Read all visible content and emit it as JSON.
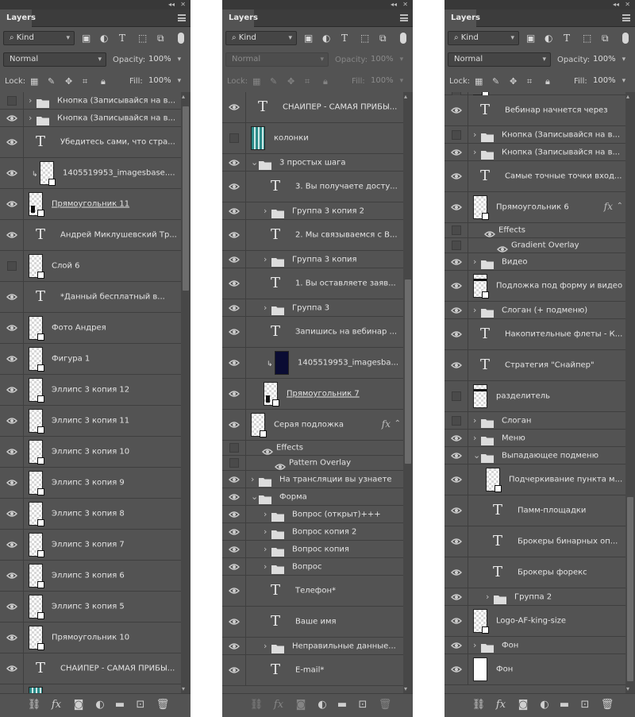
{
  "common": {
    "tab": "Layers",
    "filter": "Kind",
    "blend": "Normal",
    "opacity_label": "Opacity:",
    "opacity": "100%",
    "lock_label": "Lock:",
    "fill_label": "Fill:",
    "fill": "100%"
  },
  "panel1": {
    "layers": [
      {
        "v": 0,
        "a": 1,
        "ic": "folder",
        "t": "Кнопка (Записывайся на в...",
        "h": 22
      },
      {
        "v": 1,
        "a": 1,
        "ic": "folder",
        "t": "Кнопка (Записывайся на в...",
        "h": 22
      },
      {
        "v": 1,
        "ic": "text",
        "t": "Убедитесь сами, что стра...",
        "h": 39
      },
      {
        "v": 1,
        "ic": "thumb",
        "th": "check",
        "clip": 1,
        "t": "1405519953_imagesbase....",
        "h": 39
      },
      {
        "v": 1,
        "ic": "thumb",
        "th": "white-blk",
        "t": "Прямоугольник 11",
        "u": 1,
        "h": 39
      },
      {
        "v": 1,
        "ic": "text",
        "t": "Андрей Миклушевский Тр...",
        "h": 39
      },
      {
        "v": 0,
        "ic": "thumb",
        "th": "check",
        "t": "Слой 6",
        "h": 39
      },
      {
        "v": 1,
        "ic": "text",
        "t": "*Данный бесплатный в...",
        "h": 39
      },
      {
        "v": 1,
        "ic": "thumb",
        "th": "check",
        "t": "Фото Андрея",
        "h": 39
      },
      {
        "v": 1,
        "ic": "thumb",
        "th": "shape",
        "t": "Фигура 1",
        "h": 39
      },
      {
        "v": 1,
        "ic": "thumb",
        "th": "shape",
        "t": "Эллипс 3 копия 12",
        "h": 39
      },
      {
        "v": 1,
        "ic": "thumb",
        "th": "shape",
        "t": "Эллипс 3 копия 11",
        "h": 39
      },
      {
        "v": 1,
        "ic": "thumb",
        "th": "shape",
        "t": "Эллипс 3 копия 10",
        "h": 39
      },
      {
        "v": 1,
        "ic": "thumb",
        "th": "shape",
        "t": "Эллипс 3 копия 9",
        "h": 39
      },
      {
        "v": 1,
        "ic": "thumb",
        "th": "shape",
        "t": "Эллипс 3 копия 8",
        "h": 39
      },
      {
        "v": 1,
        "ic": "thumb",
        "th": "shape",
        "t": "Эллипс 3 копия 7",
        "h": 39
      },
      {
        "v": 1,
        "ic": "thumb",
        "th": "shape",
        "t": "Эллипс 3 копия 6",
        "h": 39
      },
      {
        "v": 1,
        "ic": "thumb",
        "th": "shape",
        "t": "Эллипс 3 копия 5",
        "h": 39
      },
      {
        "v": 1,
        "ic": "thumb",
        "th": "shape",
        "t": "Прямоугольник 10",
        "h": 39
      },
      {
        "v": 1,
        "ic": "text",
        "t": "СНАЙПЕР - САМАЯ ПРИБЫ...",
        "h": 39
      },
      {
        "v": 1,
        "ic": "thumb",
        "th": "teal",
        "t": "",
        "h": 30
      }
    ]
  },
  "panel2": {
    "layers": [
      {
        "v": 1,
        "ic": "text",
        "t": "СНАЙПЕР - САМАЯ ПРИБЫ...",
        "h": 39
      },
      {
        "v": 0,
        "ic": "thumb",
        "th": "teal",
        "t": "колонки",
        "h": 39
      },
      {
        "v": 1,
        "a": 2,
        "ic": "folder",
        "t": "3 простых шага",
        "h": 22
      },
      {
        "v": 1,
        "ind": 1,
        "ic": "text",
        "t": "3. Вы получаете досту...",
        "h": 39
      },
      {
        "v": 1,
        "ind": 1,
        "a": 1,
        "ic": "folder",
        "t": "Группа 3 копия 2",
        "h": 22
      },
      {
        "v": 1,
        "ind": 1,
        "ic": "text",
        "t": "2. Мы связываемся с В...",
        "h": 39
      },
      {
        "v": 1,
        "ind": 1,
        "a": 1,
        "ic": "folder",
        "t": "Группа 3 копия",
        "h": 22
      },
      {
        "v": 1,
        "ind": 1,
        "ic": "text",
        "t": "1. Вы оставляете заяв...",
        "h": 39
      },
      {
        "v": 1,
        "ind": 1,
        "a": 1,
        "ic": "folder",
        "t": "Группа 3",
        "h": 22
      },
      {
        "v": 1,
        "ind": 1,
        "ic": "text",
        "t": "Запишись на вебинар ...",
        "h": 39
      },
      {
        "v": 1,
        "ind": 1,
        "ic": "thumb",
        "th": "dark",
        "clip": 1,
        "t": "1405519953_imagesba...",
        "h": 39
      },
      {
        "v": 1,
        "ind": 1,
        "ic": "thumb",
        "th": "white-blk",
        "t": "Прямоугольник 7",
        "u": 1,
        "h": 39
      },
      {
        "v": 1,
        "ic": "thumb",
        "th": "shape",
        "t": "Серая подложка",
        "fx": 1,
        "h": 39
      },
      {
        "v": 0,
        "sub": 1,
        "t": "Effects",
        "h": 19
      },
      {
        "v": 0,
        "sub": 2,
        "t": "Pattern Overlay",
        "h": 19
      },
      {
        "v": 1,
        "a": 1,
        "ic": "folder",
        "t": "На трансляции вы узнаете",
        "h": 22
      },
      {
        "v": 1,
        "a": 2,
        "ic": "folder",
        "t": "Форма",
        "h": 22
      },
      {
        "v": 1,
        "ind": 1,
        "a": 1,
        "ic": "folder",
        "t": "Вопрос (открыт)+++",
        "h": 22
      },
      {
        "v": 1,
        "ind": 1,
        "a": 1,
        "ic": "folder",
        "t": "Вопрос копия 2",
        "h": 22
      },
      {
        "v": 1,
        "ind": 1,
        "a": 1,
        "ic": "folder",
        "t": "Вопрос копия",
        "h": 22
      },
      {
        "v": 1,
        "ind": 1,
        "a": 1,
        "ic": "folder",
        "t": "Вопрос",
        "h": 22
      },
      {
        "v": 1,
        "ind": 1,
        "ic": "text",
        "t": "Телефон*",
        "h": 39
      },
      {
        "v": 1,
        "ind": 1,
        "ic": "text",
        "t": "Ваше имя",
        "h": 39
      },
      {
        "v": 1,
        "ind": 1,
        "a": 1,
        "ic": "folder",
        "t": "Неправильные данные...",
        "h": 22
      },
      {
        "v": 1,
        "ind": 1,
        "ic": "text",
        "t": "E-mail*",
        "h": 39
      }
    ]
  },
  "panel3": {
    "layers": [
      {
        "v": 0,
        "ic": "thumb",
        "th": "check",
        "t": "",
        "h": 4
      },
      {
        "v": 1,
        "ic": "text",
        "t": "Вебинар начнется через",
        "h": 39
      },
      {
        "v": 0,
        "a": 1,
        "ic": "folder",
        "t": "Кнопка (Записывайся на в...",
        "h": 22
      },
      {
        "v": 1,
        "a": 1,
        "ic": "folder",
        "t": "Кнопка (Записывайся на в...",
        "h": 22
      },
      {
        "v": 1,
        "ic": "text",
        "t": "Самые точные точки вход...",
        "h": 39
      },
      {
        "v": 1,
        "ic": "thumb",
        "th": "shape",
        "t": "Прямоугольник 6",
        "fx": 1,
        "h": 39
      },
      {
        "v": 0,
        "sub": 1,
        "t": "Effects",
        "h": 19
      },
      {
        "v": 0,
        "sub": 2,
        "t": "Gradient Overlay",
        "h": 19
      },
      {
        "v": 1,
        "a": 1,
        "ic": "folder",
        "t": "Видео",
        "h": 22
      },
      {
        "v": 1,
        "ic": "thumb",
        "th": "barshape",
        "t": "Подложка под форму и видео",
        "h": 39
      },
      {
        "v": 1,
        "a": 1,
        "ic": "folder",
        "t": "Слоган (+ подменю)",
        "h": 22
      },
      {
        "v": 1,
        "ic": "text",
        "t": "Накопительные флеты - К...",
        "h": 39
      },
      {
        "v": 1,
        "ic": "text",
        "t": "Стратегия \"Снайпер\"",
        "h": 39
      },
      {
        "v": 0,
        "ic": "thumb",
        "th": "bar",
        "t": "разделитель",
        "h": 39
      },
      {
        "v": 0,
        "a": 1,
        "ic": "folder",
        "t": "Слоган",
        "h": 22
      },
      {
        "v": 1,
        "a": 1,
        "ic": "folder",
        "t": "Меню",
        "h": 22
      },
      {
        "v": 1,
        "a": 2,
        "ic": "folder",
        "t": "Выпадающее подменю",
        "h": 22
      },
      {
        "v": 1,
        "ind": 1,
        "ic": "thumb",
        "th": "check",
        "t": "Подчеркивание пункта м...",
        "h": 39
      },
      {
        "v": 1,
        "ind": 1,
        "ic": "text",
        "t": "Памм-площадки",
        "h": 39
      },
      {
        "v": 1,
        "ind": 1,
        "ic": "text",
        "t": "Брокеры бинарных оп...",
        "h": 39
      },
      {
        "v": 1,
        "ind": 1,
        "ic": "text",
        "t": "Брокеры форекс",
        "h": 39
      },
      {
        "v": 1,
        "ind": 1,
        "a": 1,
        "ic": "folder",
        "t": "Группа 2",
        "h": 22
      },
      {
        "v": 1,
        "ic": "thumb",
        "th": "shape",
        "t": "Logo-AF-king-size",
        "h": 39
      },
      {
        "v": 1,
        "a": 1,
        "ic": "folder",
        "t": "Фон",
        "h": 22
      },
      {
        "v": 1,
        "ic": "thumb",
        "th": "white",
        "t": "Фон",
        "h": 39
      }
    ]
  }
}
